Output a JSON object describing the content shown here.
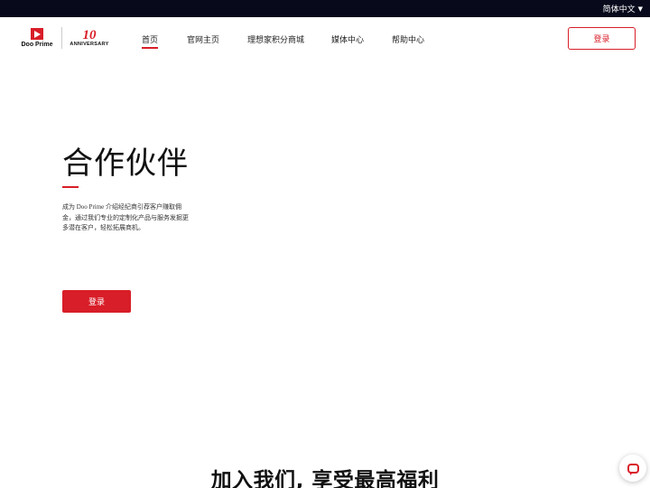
{
  "topbar": {
    "language": "简体中文",
    "caret_icon": "caret-down-icon"
  },
  "logo": {
    "brand": "Doo Prime",
    "anniversary_number": "10",
    "anniversary_text": "ANNIVERSARY"
  },
  "nav": {
    "items": [
      {
        "label": "首页",
        "active": true
      },
      {
        "label": "官网主页"
      },
      {
        "label": "理想家积分商城"
      },
      {
        "label": "媒体中心"
      },
      {
        "label": "帮助中心"
      }
    ],
    "login_label": "登录"
  },
  "hero": {
    "title": "合作伙伴",
    "description": "成为 Doo Prime 介绍经纪商引荐客户赚取佣金，通过我们专业的定制化产品与服务发掘更多潜在客户，轻松拓展商机。",
    "button_label": "登录"
  },
  "section": {
    "title": "加入我们, 享受最高福利"
  },
  "colors": {
    "accent": "#d81e28",
    "topbar": "#080a1c"
  },
  "chat": {
    "icon": "chat-icon"
  }
}
